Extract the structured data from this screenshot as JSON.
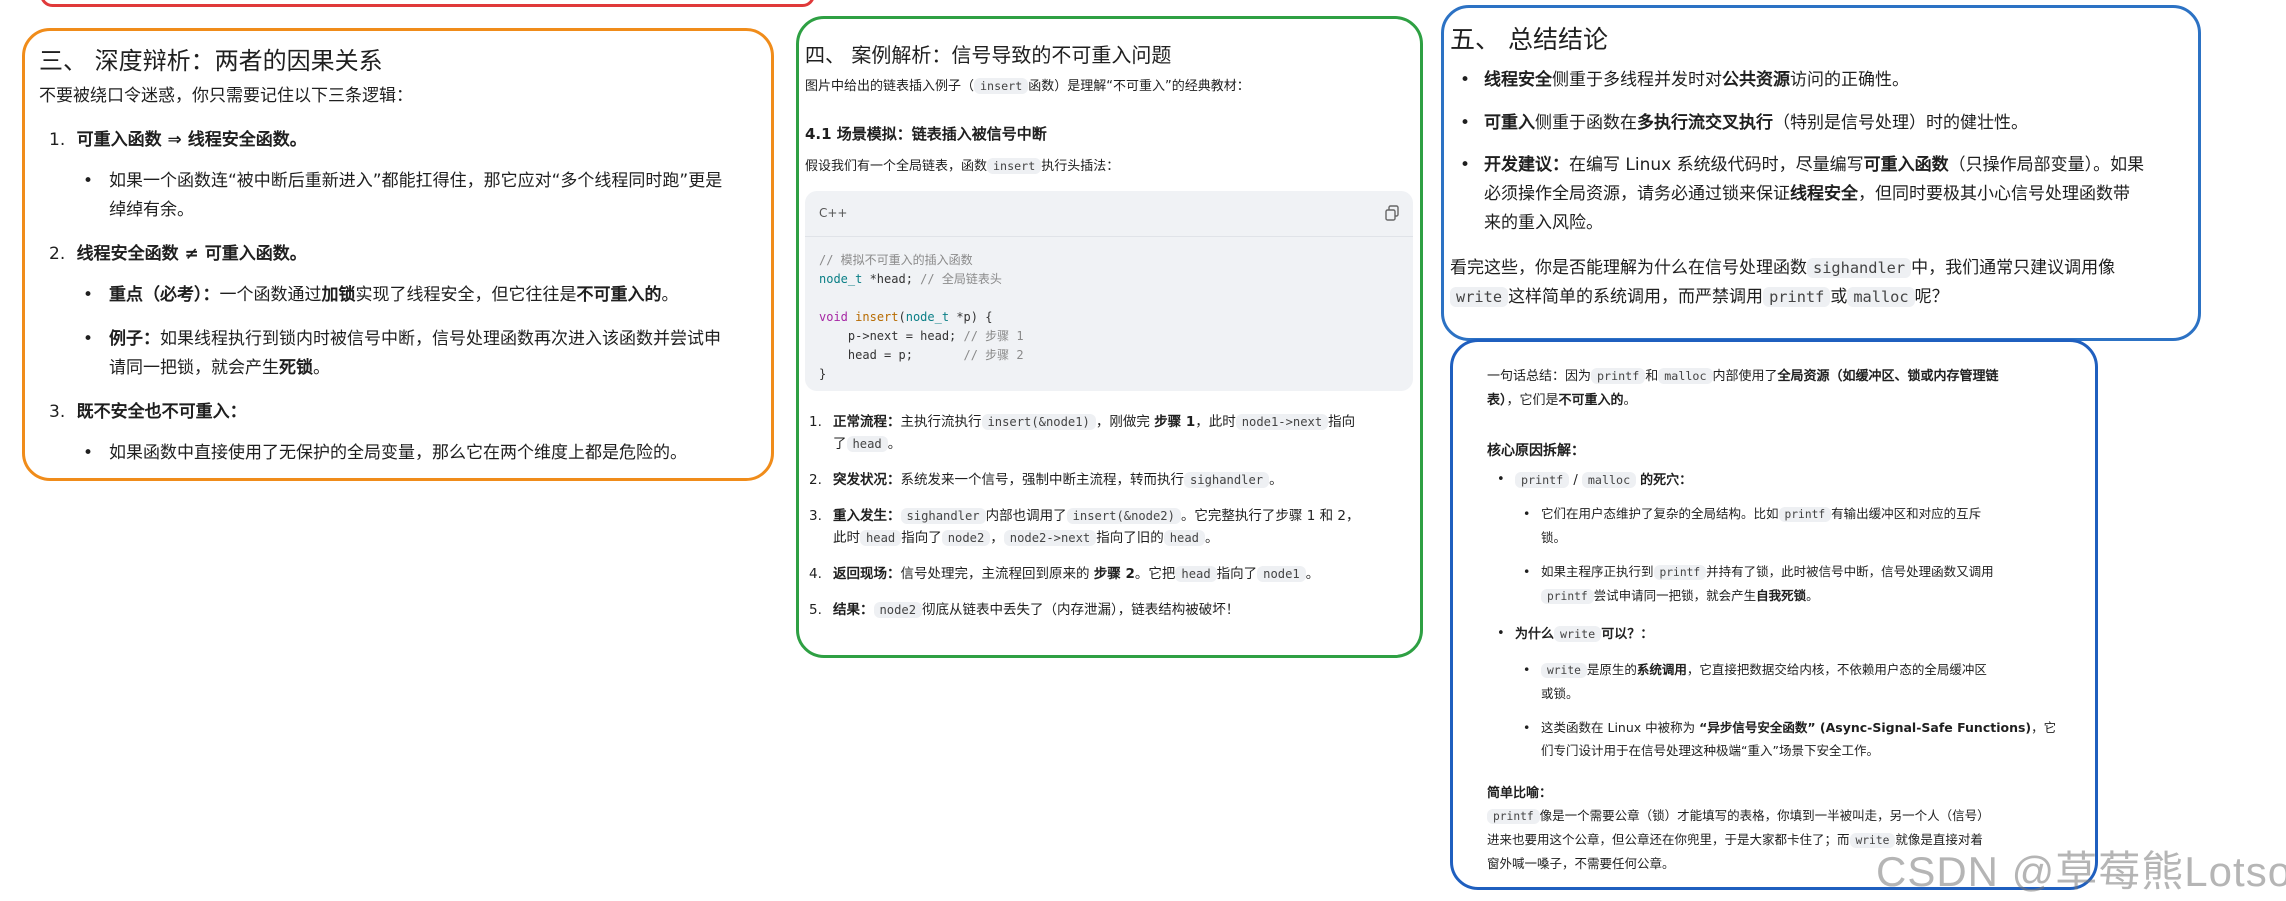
{
  "p3": {
    "title": "三、 深度辩析：两者的因果关系",
    "intro": "不要被绕口令迷惑，你只需要记住以下三条逻辑：",
    "items": [
      {
        "num": "1.",
        "head": "可重入函数 ⇒ 线程安全函数。"
      },
      {
        "num": "2.",
        "head": "线程安全函数 ≠ 可重入函数。"
      },
      {
        "num": "3.",
        "head": "既不安全也不可重入："
      }
    ],
    "b1": "如果一个函数连“被中断后重新进入”都能扛得住，那它应对“多个线程同时跑”更是",
    "b1b": "绰绰有余。",
    "b2a_label": "重点（必考）：",
    "b2a_1": "一个函数通过",
    "b2a_bold": "加锁",
    "b2a_2": "实现了线程安全，但它往往是",
    "b2a_bold2": "不可重入的",
    "b2a_3": "。",
    "b2b_label": "例子：",
    "b2b_1": "如果线程执行到锁内时被信号中断，信号处理函数再次进入该函数并尝试申",
    "b2b_2": "请同一把锁，就会产生",
    "b2b_bold": "死锁",
    "b2b_3": "。",
    "b3": "如果函数中直接使用了无保护的全局变量，那么它在两个维度上都是危险的。"
  },
  "p4": {
    "title": "四、 案例解析：信号导致的不可重入问题",
    "intro_1": "图片中给出的链表插入例子（",
    "intro_code": "insert",
    "intro_2": "函数）是理解“不可重入”的经典教材：",
    "sub": "4.1 场景模拟：链表插入被信号中断",
    "sub_intro_1": "假设我们有一个全局链表，函数",
    "sub_intro_code": "insert",
    "sub_intro_2": "执行头插法：",
    "code_lang": "C++",
    "code": {
      "l1": "// 模拟不可重入的插入函数",
      "l2a": "node_t",
      "l2b": " *head; ",
      "l2c": "// 全局链表头",
      "l3a": "void",
      "l3b": "insert",
      "l3c": "(",
      "l3d": "node_t",
      "l3e": " *p) {",
      "l4a": "    p->next = head; ",
      "l4b": "// 步骤 1",
      "l5a": "    head = p;       ",
      "l5b": "// 步骤 2",
      "l6": "}"
    },
    "steps": [
      {
        "num": "1.",
        "label": "正常流程：",
        "t1": "主执行流执行",
        "c1": "insert(&node1)",
        "t2": "，刚做完 ",
        "b1": "步骤 1",
        "t3": "，此时",
        "c2": "node1->next",
        "t4": "指向",
        "t5": "了",
        "c3": "head",
        "t6": "。"
      },
      {
        "num": "2.",
        "label": "突发状况：",
        "t1": "系统发来一个信号，强制中断主流程，转而执行",
        "c1": "sighandler",
        "t2": "。"
      },
      {
        "num": "3.",
        "label": "重入发生：",
        "c0": "sighandler",
        "t1": "内部也调用了",
        "c1": "insert(&node2)",
        "t2": "。它完整执行了步骤 1 和 2，",
        "t3": "此时",
        "c2": "head",
        "t4": "指向了",
        "c3": "node2",
        "t5": "，",
        "c4": "node2->next",
        "t6": "指向了旧的",
        "c5": "head",
        "t7": "。"
      },
      {
        "num": "4.",
        "label": "返回现场：",
        "t1": "信号处理完，主流程回到原来的 ",
        "b1": "步骤 2",
        "t2": "。它把",
        "c1": "head",
        "t3": "指向了",
        "c2": "node1",
        "t4": "。"
      },
      {
        "num": "5.",
        "label": "结果：",
        "c0": "node2",
        "t1": "彻底从链表中丢失了（内存泄漏），链表结构被破坏！"
      }
    ]
  },
  "p5": {
    "title": "五、 总结结论",
    "b1_bold": "线程安全",
    "b1_1": "侧重于多线程并发时对",
    "b1_bold2": "公共资源",
    "b1_2": "访问的正确性。",
    "b2_bold": "可重入",
    "b2_1": "侧重于函数在",
    "b2_bold2": "多执行流交叉执行",
    "b2_2": "（特别是信号处理）时的健壮性。",
    "b3_bold": "开发建议：",
    "b3_1": "在编写 Linux 系统级代码时，尽量编写",
    "b3_bold2": "可重入函数",
    "b3_2": "（只操作局部变量）。如果",
    "b3_3": "必须操作全局资源，请务必通过锁来保证",
    "b3_bold3": "线程安全",
    "b3_4": "，但同时要极其小心信号处理函数带",
    "b3_5": "来的重入风险。",
    "q_1": "看完这些，你是否能理解为什么在信号处理函数",
    "q_c1": "sighandler",
    "q_2": "中，我们通常只建议调用像",
    "q_c2": "write",
    "q_3": "这样简单的系统调用，而严禁调用",
    "q_c3": "printf",
    "q_4": "或",
    "q_c4": "malloc",
    "q_5": "呢？"
  },
  "p6": {
    "s1": "一句话总结：因为",
    "s_c1": "printf",
    "s2": "和",
    "s_c2": "malloc",
    "s3": "内部使用了",
    "s_bold": "全局资源（如缓冲区、锁或内存管理链",
    "s_bold2": "表）",
    "s4": "，它们是",
    "s_bold3": "不可重入的",
    "s5": "。",
    "core": "核心原因拆解：",
    "g1_c1": "printf",
    "g1_sep": " / ",
    "g1_c2": "malloc",
    "g1_t": "的死穴：",
    "g1_b1_1": "它们在用户态维护了复杂的全局结构。比如",
    "g1_b1_c": "printf",
    "g1_b1_2": "有输出缓冲区和对应的互斥",
    "g1_b1_3": "锁。",
    "g1_b2_1": "如果主程序正执行到",
    "g1_b2_c": "printf",
    "g1_b2_2": "并持有了锁，此时被信号中断，信号处理函数又调用",
    "g1_b2_c2": "printf",
    "g1_b2_3": "尝试申请同一把锁，就会产生",
    "g1_b2_bold": "自我死锁",
    "g1_b2_4": "。",
    "g2_1": "为什么",
    "g2_c": "write",
    "g2_2": "可以？：",
    "g2_b1_c": "write",
    "g2_b1_1": "是原生的",
    "g2_b1_bold": "系统调用",
    "g2_b1_2": "，它直接把数据交给内核，不依赖用户态的全局缓冲区",
    "g2_b1_3": "或锁。",
    "g2_b2_1": "这类函数在 Linux 中被称为 ",
    "g2_b2_bold": "“异步信号安全函数” (Async-Signal-Safe Functions)",
    "g2_b2_2": "，它",
    "g2_b2_3": "们专门设计用于在信号处理这种极端“重入”场景下安全工作。",
    "sim": "简单比喻：",
    "sim_c1": "printf",
    "sim_1": "像是一个需要公章（锁）才能填写的表格，你填到一半被叫走，另一个人（信号）",
    "sim_2": "进来也要用这个公章，但公章还在你兜里，于是大家都卡住了；而",
    "sim_c2": "write",
    "sim_3": "就像是直接对着",
    "sim_4": "窗外喊一嗓子，不需要任何公章。"
  },
  "watermark": "CSDN @草莓熊Lotso"
}
